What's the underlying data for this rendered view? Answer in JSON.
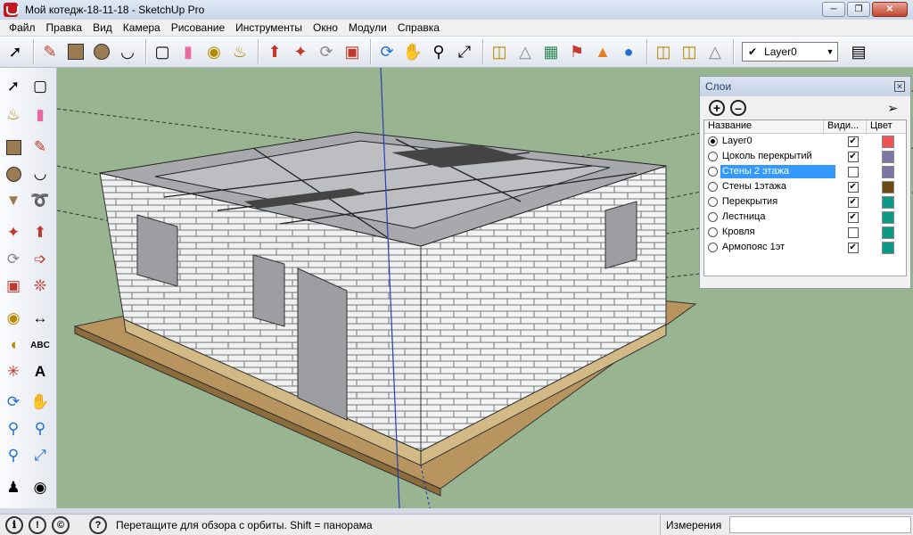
{
  "window": {
    "title": "Мой котедж-18-11-18 - SketchUp Pro"
  },
  "menu": [
    "Файл",
    "Правка",
    "Вид",
    "Камера",
    "Рисование",
    "Инструменты",
    "Окно",
    "Модули",
    "Справка"
  ],
  "toolbar": {
    "current_layer": "Layer0"
  },
  "layers_panel": {
    "title": "Слои",
    "columns": {
      "name": "Название",
      "visible": "Види...",
      "color": "Цвет"
    },
    "rows": [
      {
        "name": "Layer0",
        "active": true,
        "visible": true,
        "color": "#f15454"
      },
      {
        "name": "Цоколь перекрытий",
        "active": false,
        "visible": true,
        "color": "#7c76a6"
      },
      {
        "name": "Стены 2 этажа",
        "active": false,
        "visible": false,
        "color": "#7c76a6",
        "selected": true
      },
      {
        "name": "Стены 1этажа",
        "active": false,
        "visible": true,
        "color": "#6b4a10"
      },
      {
        "name": "Перекрытия",
        "active": false,
        "visible": true,
        "color": "#0c9a86"
      },
      {
        "name": "Лестница",
        "active": false,
        "visible": true,
        "color": "#0c9a86"
      },
      {
        "name": "Кровля",
        "active": false,
        "visible": false,
        "color": "#0c9a86"
      },
      {
        "name": "Армопояс 1эт",
        "active": false,
        "visible": true,
        "color": "#0c9a86"
      }
    ]
  },
  "statusbar": {
    "hint": "Перетащите для обзора с орбиты.  Shift = панорама",
    "measure_label": "Измерения",
    "measure_value": ""
  }
}
